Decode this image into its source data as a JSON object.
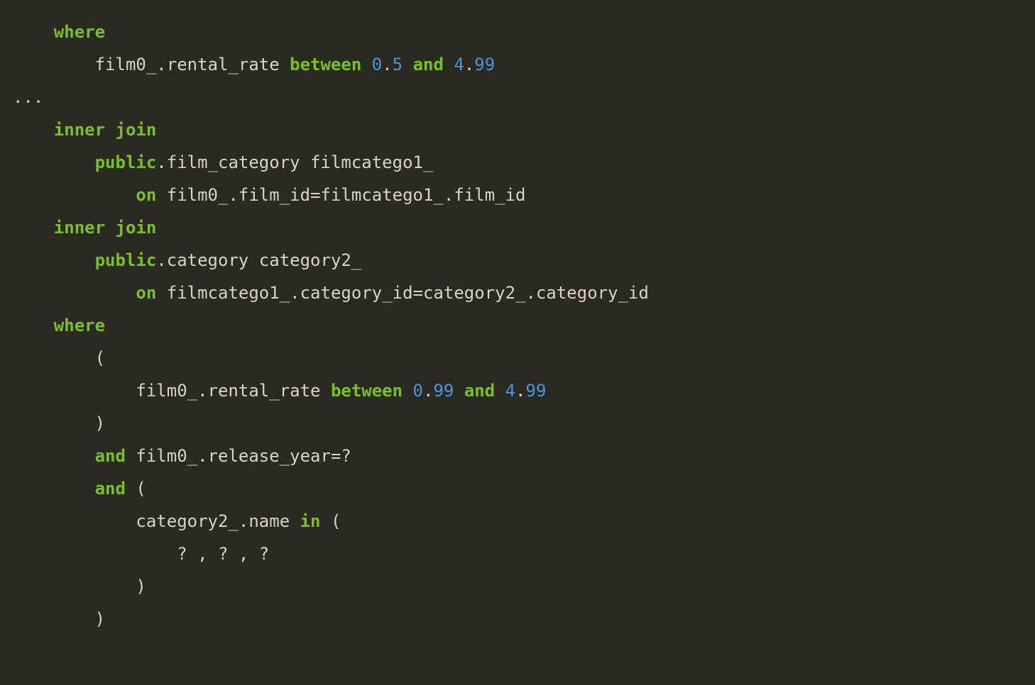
{
  "tokens": [
    {
      "indent": 2,
      "parts": [
        {
          "cls": "kw",
          "t": "where"
        }
      ]
    },
    {
      "indent": 4,
      "parts": [
        {
          "cls": "ident",
          "t": "film0_"
        },
        {
          "cls": "punct",
          "t": "."
        },
        {
          "cls": "ident",
          "t": "rental_rate "
        },
        {
          "cls": "kw",
          "t": "between"
        },
        {
          "cls": "ident",
          "t": " "
        },
        {
          "cls": "num",
          "t": "0"
        },
        {
          "cls": "punct",
          "t": "."
        },
        {
          "cls": "num",
          "t": "5"
        },
        {
          "cls": "ident",
          "t": " "
        },
        {
          "cls": "kw",
          "t": "and"
        },
        {
          "cls": "ident",
          "t": " "
        },
        {
          "cls": "num",
          "t": "4"
        },
        {
          "cls": "punct",
          "t": "."
        },
        {
          "cls": "num",
          "t": "99"
        }
      ]
    },
    {
      "indent": 0,
      "parts": [
        {
          "cls": "punct",
          "t": "..."
        }
      ]
    },
    {
      "indent": 2,
      "parts": [
        {
          "cls": "kw",
          "t": "inner"
        },
        {
          "cls": "ident",
          "t": " "
        },
        {
          "cls": "kw",
          "t": "join"
        }
      ]
    },
    {
      "indent": 4,
      "parts": [
        {
          "cls": "kw2",
          "t": "public"
        },
        {
          "cls": "punct",
          "t": "."
        },
        {
          "cls": "ident",
          "t": "film_category filmcatego1_"
        }
      ]
    },
    {
      "indent": 6,
      "parts": [
        {
          "cls": "kw2",
          "t": "on"
        },
        {
          "cls": "ident",
          "t": " film0_"
        },
        {
          "cls": "punct",
          "t": "."
        },
        {
          "cls": "ident",
          "t": "film_id"
        },
        {
          "cls": "op",
          "t": "="
        },
        {
          "cls": "ident",
          "t": "filmcatego1_"
        },
        {
          "cls": "punct",
          "t": "."
        },
        {
          "cls": "ident",
          "t": "film_id"
        }
      ]
    },
    {
      "indent": 2,
      "parts": [
        {
          "cls": "kw",
          "t": "inner"
        },
        {
          "cls": "ident",
          "t": " "
        },
        {
          "cls": "kw",
          "t": "join"
        }
      ]
    },
    {
      "indent": 4,
      "parts": [
        {
          "cls": "kw2",
          "t": "public"
        },
        {
          "cls": "punct",
          "t": "."
        },
        {
          "cls": "ident",
          "t": "category category2_"
        }
      ]
    },
    {
      "indent": 6,
      "parts": [
        {
          "cls": "kw2",
          "t": "on"
        },
        {
          "cls": "ident",
          "t": " filmcatego1_"
        },
        {
          "cls": "punct",
          "t": "."
        },
        {
          "cls": "ident",
          "t": "category_id"
        },
        {
          "cls": "op",
          "t": "="
        },
        {
          "cls": "ident",
          "t": "category2_"
        },
        {
          "cls": "punct",
          "t": "."
        },
        {
          "cls": "ident",
          "t": "category_id"
        }
      ]
    },
    {
      "indent": 2,
      "parts": [
        {
          "cls": "kw",
          "t": "where"
        }
      ]
    },
    {
      "indent": 4,
      "parts": [
        {
          "cls": "punct",
          "t": "("
        }
      ]
    },
    {
      "indent": 6,
      "parts": [
        {
          "cls": "ident",
          "t": "film0_"
        },
        {
          "cls": "punct",
          "t": "."
        },
        {
          "cls": "ident",
          "t": "rental_rate "
        },
        {
          "cls": "kw",
          "t": "between"
        },
        {
          "cls": "ident",
          "t": " "
        },
        {
          "cls": "num",
          "t": "0"
        },
        {
          "cls": "punct",
          "t": "."
        },
        {
          "cls": "num",
          "t": "99"
        },
        {
          "cls": "ident",
          "t": " "
        },
        {
          "cls": "kw",
          "t": "and"
        },
        {
          "cls": "ident",
          "t": " "
        },
        {
          "cls": "num",
          "t": "4"
        },
        {
          "cls": "punct",
          "t": "."
        },
        {
          "cls": "num",
          "t": "99"
        }
      ]
    },
    {
      "indent": 4,
      "parts": [
        {
          "cls": "punct",
          "t": ")"
        }
      ]
    },
    {
      "indent": 4,
      "parts": [
        {
          "cls": "kw",
          "t": "and"
        },
        {
          "cls": "ident",
          "t": " film0_"
        },
        {
          "cls": "punct",
          "t": "."
        },
        {
          "cls": "ident",
          "t": "release_year"
        },
        {
          "cls": "op",
          "t": "="
        },
        {
          "cls": "punct",
          "t": "?"
        }
      ]
    },
    {
      "indent": 4,
      "parts": [
        {
          "cls": "kw",
          "t": "and"
        },
        {
          "cls": "ident",
          "t": " "
        },
        {
          "cls": "punct",
          "t": "("
        }
      ]
    },
    {
      "indent": 6,
      "parts": [
        {
          "cls": "ident",
          "t": "category2_"
        },
        {
          "cls": "punct",
          "t": "."
        },
        {
          "cls": "ident",
          "t": "name "
        },
        {
          "cls": "kw",
          "t": "in"
        },
        {
          "cls": "ident",
          "t": " "
        },
        {
          "cls": "punct",
          "t": "("
        }
      ]
    },
    {
      "indent": 8,
      "parts": [
        {
          "cls": "punct",
          "t": "? , ? , ?"
        }
      ]
    },
    {
      "indent": 6,
      "parts": [
        {
          "cls": "punct",
          "t": ")"
        }
      ]
    },
    {
      "indent": 4,
      "parts": [
        {
          "cls": "punct",
          "t": ")"
        }
      ]
    }
  ]
}
